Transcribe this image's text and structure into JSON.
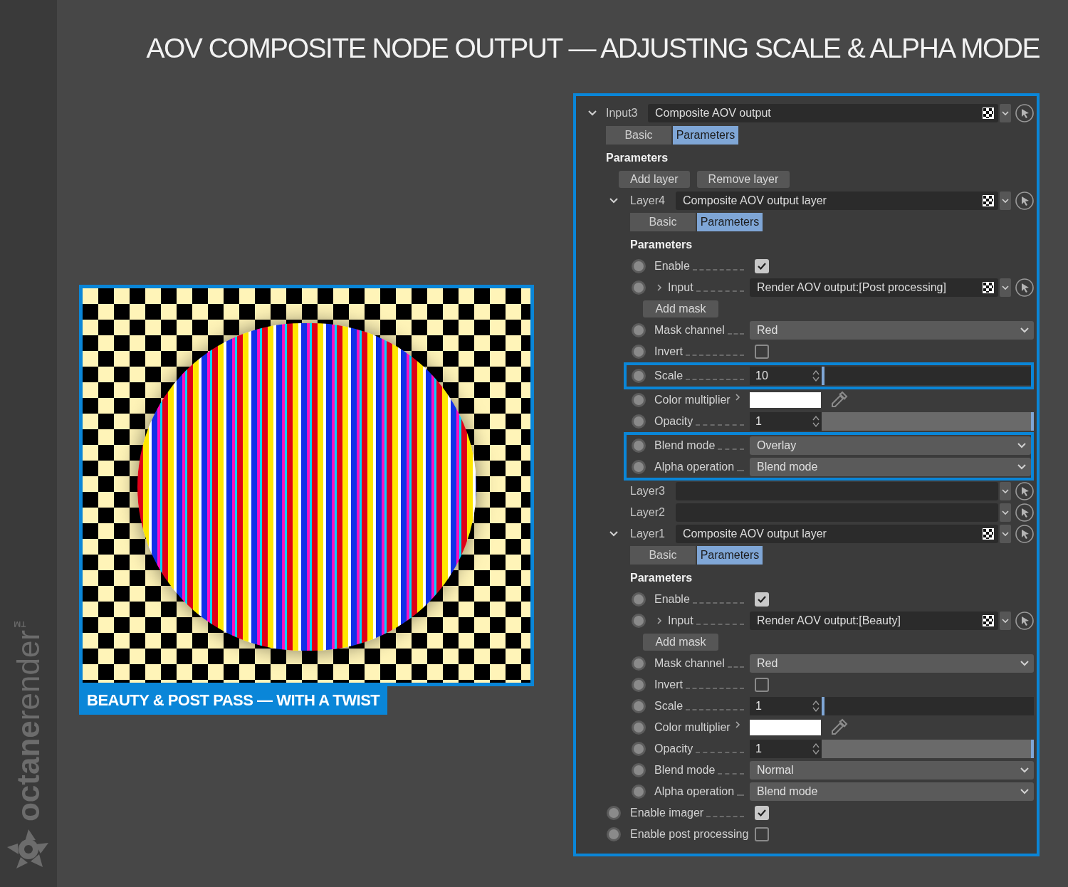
{
  "title": "AOV COMPOSITE NODE OUTPUT — ADJUSTING SCALE & ALPHA MODE",
  "brand": {
    "name_bold": "octane",
    "name_light": "render",
    "trademark": "™"
  },
  "render_preview": {
    "caption": "BEAUTY & POST PASS — WITH A TWIST"
  },
  "node_panel": {
    "expanded": true,
    "label": "Input3",
    "value": "Composite AOV output",
    "tabs": [
      {
        "label": "Basic",
        "selected": false
      },
      {
        "label": "Parameters",
        "selected": true
      }
    ],
    "section_title": "Parameters",
    "buttons": [
      "Add layer",
      "Remove layer"
    ],
    "layers": [
      {
        "expanded": true,
        "label": "Layer4",
        "value": "Composite AOV output layer",
        "tabs": [
          {
            "label": "Basic",
            "selected": false
          },
          {
            "label": "Parameters",
            "selected": true
          }
        ],
        "section_title": "Parameters",
        "params": [
          {
            "kind": "checkbox",
            "label": "Enable",
            "checked": true,
            "highlighted": false
          },
          {
            "kind": "link",
            "label": "Input",
            "value": "Render AOV output:[Post processing]",
            "highlighted": false
          },
          {
            "kind": "button",
            "label": "Add mask",
            "highlighted": false
          },
          {
            "kind": "dropdown",
            "label": "Mask channel",
            "value": "Red",
            "highlighted": false
          },
          {
            "kind": "checkbox",
            "label": "Invert",
            "checked": false,
            "highlighted": false
          },
          {
            "kind": "number",
            "label": "Scale",
            "value": "10",
            "level": 0,
            "highlighted": true
          },
          {
            "kind": "color",
            "label": "Color multiplier",
            "color": "#ffffff",
            "highlighted": false
          },
          {
            "kind": "number",
            "label": "Opacity",
            "value": "1",
            "level": 1,
            "highlighted": false
          },
          {
            "kind": "dropdown",
            "label": "Blend mode",
            "value": "Overlay",
            "highlighted": true
          },
          {
            "kind": "dropdown",
            "label": "Alpha operation",
            "value": "Blend mode",
            "highlighted": true
          }
        ]
      },
      {
        "expanded": false,
        "label": "Layer3"
      },
      {
        "expanded": false,
        "label": "Layer2"
      },
      {
        "expanded": true,
        "label": "Layer1",
        "value": "Composite AOV output layer",
        "tabs": [
          {
            "label": "Basic",
            "selected": false
          },
          {
            "label": "Parameters",
            "selected": true
          }
        ],
        "section_title": "Parameters",
        "params": [
          {
            "kind": "checkbox",
            "label": "Enable",
            "checked": true,
            "highlighted": false
          },
          {
            "kind": "link",
            "label": "Input",
            "value": "Render AOV output:[Beauty]",
            "highlighted": false
          },
          {
            "kind": "button",
            "label": "Add mask",
            "highlighted": false
          },
          {
            "kind": "dropdown",
            "label": "Mask channel",
            "value": "Red",
            "highlighted": false
          },
          {
            "kind": "checkbox",
            "label": "Invert",
            "checked": false,
            "highlighted": false
          },
          {
            "kind": "number",
            "label": "Scale",
            "value": "1",
            "level": 0,
            "highlighted": false
          },
          {
            "kind": "color",
            "label": "Color multiplier",
            "color": "#ffffff",
            "highlighted": false
          },
          {
            "kind": "number",
            "label": "Opacity",
            "value": "1",
            "level": 1,
            "highlighted": false
          },
          {
            "kind": "dropdown",
            "label": "Blend mode",
            "value": "Normal",
            "highlighted": false
          },
          {
            "kind": "dropdown",
            "label": "Alpha operation",
            "value": "Blend mode",
            "highlighted": false
          }
        ]
      }
    ],
    "settings": [
      {
        "kind": "checkbox",
        "label": "Enable imager",
        "checked": true
      },
      {
        "kind": "checkbox",
        "label": "Enable post processing",
        "checked": false
      }
    ]
  }
}
